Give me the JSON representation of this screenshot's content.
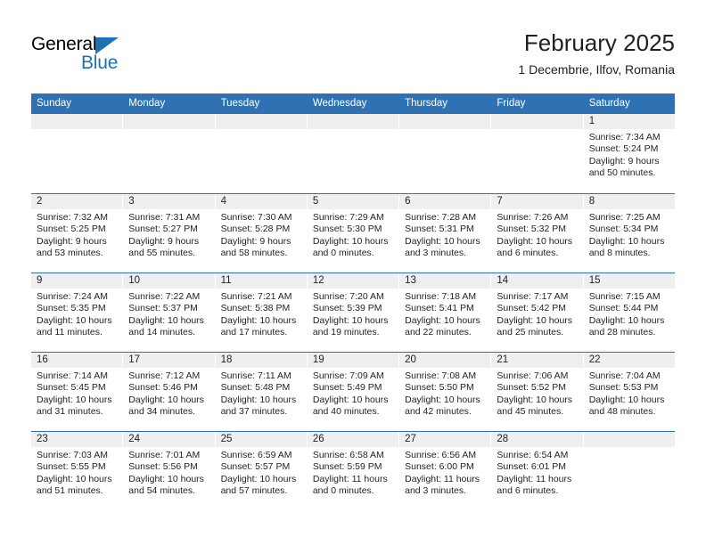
{
  "brand": {
    "name_top": "General",
    "name_bottom": "Blue"
  },
  "header": {
    "title": "February 2025",
    "subtitle": "1 Decembrie, Ilfov, Romania"
  },
  "colors": {
    "header_blue": "#2f72b4",
    "brand_blue": "#1b72b8",
    "day_number_bg": "#efefef",
    "text": "#231f20"
  },
  "weekdays": [
    "Sunday",
    "Monday",
    "Tuesday",
    "Wednesday",
    "Thursday",
    "Friday",
    "Saturday"
  ],
  "labels": {
    "sunrise_prefix": "Sunrise:",
    "sunset_prefix": "Sunset:",
    "daylight_prefix": "Daylight:"
  },
  "weeks": [
    [
      {
        "day": "",
        "sunrise": "",
        "sunset": "",
        "daylight_line1": "",
        "daylight_line2": ""
      },
      {
        "day": "",
        "sunrise": "",
        "sunset": "",
        "daylight_line1": "",
        "daylight_line2": ""
      },
      {
        "day": "",
        "sunrise": "",
        "sunset": "",
        "daylight_line1": "",
        "daylight_line2": ""
      },
      {
        "day": "",
        "sunrise": "",
        "sunset": "",
        "daylight_line1": "",
        "daylight_line2": ""
      },
      {
        "day": "",
        "sunrise": "",
        "sunset": "",
        "daylight_line1": "",
        "daylight_line2": ""
      },
      {
        "day": "",
        "sunrise": "",
        "sunset": "",
        "daylight_line1": "",
        "daylight_line2": ""
      },
      {
        "day": "1",
        "sunrise": "Sunrise: 7:34 AM",
        "sunset": "Sunset: 5:24 PM",
        "daylight_line1": "Daylight: 9 hours",
        "daylight_line2": "and 50 minutes."
      }
    ],
    [
      {
        "day": "2",
        "sunrise": "Sunrise: 7:32 AM",
        "sunset": "Sunset: 5:25 PM",
        "daylight_line1": "Daylight: 9 hours",
        "daylight_line2": "and 53 minutes."
      },
      {
        "day": "3",
        "sunrise": "Sunrise: 7:31 AM",
        "sunset": "Sunset: 5:27 PM",
        "daylight_line1": "Daylight: 9 hours",
        "daylight_line2": "and 55 minutes."
      },
      {
        "day": "4",
        "sunrise": "Sunrise: 7:30 AM",
        "sunset": "Sunset: 5:28 PM",
        "daylight_line1": "Daylight: 9 hours",
        "daylight_line2": "and 58 minutes."
      },
      {
        "day": "5",
        "sunrise": "Sunrise: 7:29 AM",
        "sunset": "Sunset: 5:30 PM",
        "daylight_line1": "Daylight: 10 hours",
        "daylight_line2": "and 0 minutes."
      },
      {
        "day": "6",
        "sunrise": "Sunrise: 7:28 AM",
        "sunset": "Sunset: 5:31 PM",
        "daylight_line1": "Daylight: 10 hours",
        "daylight_line2": "and 3 minutes."
      },
      {
        "day": "7",
        "sunrise": "Sunrise: 7:26 AM",
        "sunset": "Sunset: 5:32 PM",
        "daylight_line1": "Daylight: 10 hours",
        "daylight_line2": "and 6 minutes."
      },
      {
        "day": "8",
        "sunrise": "Sunrise: 7:25 AM",
        "sunset": "Sunset: 5:34 PM",
        "daylight_line1": "Daylight: 10 hours",
        "daylight_line2": "and 8 minutes."
      }
    ],
    [
      {
        "day": "9",
        "sunrise": "Sunrise: 7:24 AM",
        "sunset": "Sunset: 5:35 PM",
        "daylight_line1": "Daylight: 10 hours",
        "daylight_line2": "and 11 minutes."
      },
      {
        "day": "10",
        "sunrise": "Sunrise: 7:22 AM",
        "sunset": "Sunset: 5:37 PM",
        "daylight_line1": "Daylight: 10 hours",
        "daylight_line2": "and 14 minutes."
      },
      {
        "day": "11",
        "sunrise": "Sunrise: 7:21 AM",
        "sunset": "Sunset: 5:38 PM",
        "daylight_line1": "Daylight: 10 hours",
        "daylight_line2": "and 17 minutes."
      },
      {
        "day": "12",
        "sunrise": "Sunrise: 7:20 AM",
        "sunset": "Sunset: 5:39 PM",
        "daylight_line1": "Daylight: 10 hours",
        "daylight_line2": "and 19 minutes."
      },
      {
        "day": "13",
        "sunrise": "Sunrise: 7:18 AM",
        "sunset": "Sunset: 5:41 PM",
        "daylight_line1": "Daylight: 10 hours",
        "daylight_line2": "and 22 minutes."
      },
      {
        "day": "14",
        "sunrise": "Sunrise: 7:17 AM",
        "sunset": "Sunset: 5:42 PM",
        "daylight_line1": "Daylight: 10 hours",
        "daylight_line2": "and 25 minutes."
      },
      {
        "day": "15",
        "sunrise": "Sunrise: 7:15 AM",
        "sunset": "Sunset: 5:44 PM",
        "daylight_line1": "Daylight: 10 hours",
        "daylight_line2": "and 28 minutes."
      }
    ],
    [
      {
        "day": "16",
        "sunrise": "Sunrise: 7:14 AM",
        "sunset": "Sunset: 5:45 PM",
        "daylight_line1": "Daylight: 10 hours",
        "daylight_line2": "and 31 minutes."
      },
      {
        "day": "17",
        "sunrise": "Sunrise: 7:12 AM",
        "sunset": "Sunset: 5:46 PM",
        "daylight_line1": "Daylight: 10 hours",
        "daylight_line2": "and 34 minutes."
      },
      {
        "day": "18",
        "sunrise": "Sunrise: 7:11 AM",
        "sunset": "Sunset: 5:48 PM",
        "daylight_line1": "Daylight: 10 hours",
        "daylight_line2": "and 37 minutes."
      },
      {
        "day": "19",
        "sunrise": "Sunrise: 7:09 AM",
        "sunset": "Sunset: 5:49 PM",
        "daylight_line1": "Daylight: 10 hours",
        "daylight_line2": "and 40 minutes."
      },
      {
        "day": "20",
        "sunrise": "Sunrise: 7:08 AM",
        "sunset": "Sunset: 5:50 PM",
        "daylight_line1": "Daylight: 10 hours",
        "daylight_line2": "and 42 minutes."
      },
      {
        "day": "21",
        "sunrise": "Sunrise: 7:06 AM",
        "sunset": "Sunset: 5:52 PM",
        "daylight_line1": "Daylight: 10 hours",
        "daylight_line2": "and 45 minutes."
      },
      {
        "day": "22",
        "sunrise": "Sunrise: 7:04 AM",
        "sunset": "Sunset: 5:53 PM",
        "daylight_line1": "Daylight: 10 hours",
        "daylight_line2": "and 48 minutes."
      }
    ],
    [
      {
        "day": "23",
        "sunrise": "Sunrise: 7:03 AM",
        "sunset": "Sunset: 5:55 PM",
        "daylight_line1": "Daylight: 10 hours",
        "daylight_line2": "and 51 minutes."
      },
      {
        "day": "24",
        "sunrise": "Sunrise: 7:01 AM",
        "sunset": "Sunset: 5:56 PM",
        "daylight_line1": "Daylight: 10 hours",
        "daylight_line2": "and 54 minutes."
      },
      {
        "day": "25",
        "sunrise": "Sunrise: 6:59 AM",
        "sunset": "Sunset: 5:57 PM",
        "daylight_line1": "Daylight: 10 hours",
        "daylight_line2": "and 57 minutes."
      },
      {
        "day": "26",
        "sunrise": "Sunrise: 6:58 AM",
        "sunset": "Sunset: 5:59 PM",
        "daylight_line1": "Daylight: 11 hours",
        "daylight_line2": "and 0 minutes."
      },
      {
        "day": "27",
        "sunrise": "Sunrise: 6:56 AM",
        "sunset": "Sunset: 6:00 PM",
        "daylight_line1": "Daylight: 11 hours",
        "daylight_line2": "and 3 minutes."
      },
      {
        "day": "28",
        "sunrise": "Sunrise: 6:54 AM",
        "sunset": "Sunset: 6:01 PM",
        "daylight_line1": "Daylight: 11 hours",
        "daylight_line2": "and 6 minutes."
      },
      {
        "day": "",
        "sunrise": "",
        "sunset": "",
        "daylight_line1": "",
        "daylight_line2": ""
      }
    ]
  ]
}
